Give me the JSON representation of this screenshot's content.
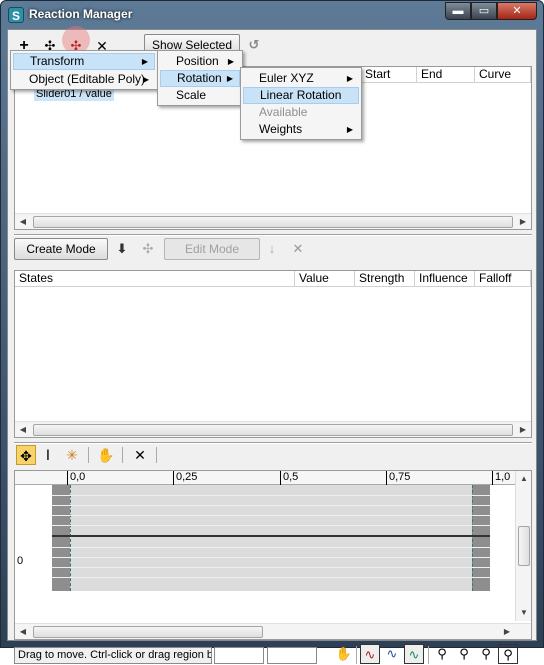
{
  "window": {
    "title": "Reaction Manager",
    "app_icon_glyph": "S",
    "controls": {
      "minimize": "▬",
      "maximize": "▭",
      "close": "✕"
    }
  },
  "toolbar": {
    "add_icon": "plus-icon",
    "add_selected_icon": "add-selected-icon",
    "add_highlighted_icon": "add-highlighted-icon",
    "delete_icon": "delete-icon",
    "show_selected_label": "Show Selected",
    "refresh_icon": "refresh-icon"
  },
  "reactions_table": {
    "columns": [
      "Start",
      "End",
      "Curve"
    ],
    "rows": [
      {
        "label": "Slider01 / value"
      }
    ]
  },
  "menus": {
    "level1": [
      {
        "label": "Transform",
        "highlighted": true,
        "enabled": true,
        "has_submenu": true
      },
      {
        "label": "Object (Editable Poly)",
        "highlighted": false,
        "enabled": true,
        "has_submenu": true
      }
    ],
    "level2": [
      {
        "label": "Position",
        "highlighted": false,
        "enabled": true,
        "has_submenu": true
      },
      {
        "label": "Rotation",
        "highlighted": true,
        "enabled": true,
        "has_submenu": true
      },
      {
        "label": "Scale",
        "highlighted": false,
        "enabled": true,
        "has_submenu": false
      }
    ],
    "level3": [
      {
        "label": "Euler XYZ",
        "highlighted": false,
        "enabled": true,
        "has_submenu": true
      },
      {
        "label": "Linear Rotation",
        "highlighted": true,
        "enabled": true,
        "has_submenu": false
      },
      {
        "label": "Available",
        "highlighted": false,
        "enabled": false,
        "has_submenu": false
      },
      {
        "label": "Weights",
        "highlighted": false,
        "enabled": true,
        "has_submenu": true
      }
    ]
  },
  "states_toolbar": {
    "create_mode_label": "Create Mode",
    "edit_mode_label": "Edit Mode"
  },
  "states_table": {
    "columns": [
      "States",
      "Value",
      "Strength",
      "Influence",
      "Falloff"
    ]
  },
  "curve_editor": {
    "ruler_labels": [
      "0,0",
      "0,25",
      "0,5",
      "0,75",
      "1,0"
    ],
    "y_label": "0"
  },
  "status_bar": {
    "message": "Drag to move. Ctrl-click or drag region b",
    "field1": "",
    "field2": ""
  },
  "colors": {
    "menu_highlight": "#c8e2f7",
    "title_bar": "#4a6583",
    "close_button": "#c24a36"
  }
}
